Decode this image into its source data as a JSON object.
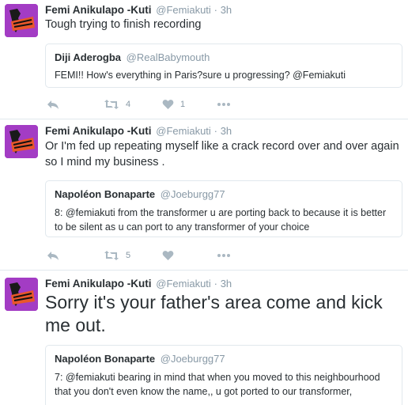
{
  "tweets": [
    {
      "name": "Femi Anikulapo -Kuti",
      "handle": "@Femiakuti",
      "dot": "·",
      "time": "3h",
      "text": "Tough trying to finish recording",
      "quote": {
        "name": "Diji Aderogba",
        "handle": "@RealBabymouth",
        "text": "FEMI!! How's everything in Paris?sure u progressing? @Femiakuti"
      },
      "retweets": "4",
      "likes": "1"
    },
    {
      "name": "Femi Anikulapo -Kuti",
      "handle": "@Femiakuti",
      "dot": "·",
      "time": "3h",
      "text": "Or I'm fed up repeating myself like a crack record over and over again so I mind my business .",
      "quote": {
        "name": "Napoléon Bonaparte",
        "handle": "@Joeburgg77",
        "text": "8: @femiakuti from the transformer u are porting back to because it is better to be silent as u can port to any transformer of your choice"
      },
      "retweets": "5",
      "likes": ""
    },
    {
      "name": "Femi Anikulapo -Kuti",
      "handle": "@Femiakuti",
      "dot": "·",
      "time": "3h",
      "text": "Sorry it's your father's area come and kick me out.",
      "quote": {
        "name": "Napoléon Bonaparte",
        "handle": "@Joeburgg77",
        "text": "7: @femiakuti bearing in mind that when you moved to this neighbourhood that you don't even know the name,, u got ported to our transformer,"
      }
    }
  ],
  "icons": {
    "reply": "reply-icon",
    "retweet": "retweet-icon",
    "like": "heart-icon",
    "more": "more-icon"
  },
  "colors": {
    "avatar_bg": "#a33cc4",
    "meta_gray": "#8899a6",
    "icon_gray": "#aab8c2",
    "border": "#e1e8ed"
  }
}
